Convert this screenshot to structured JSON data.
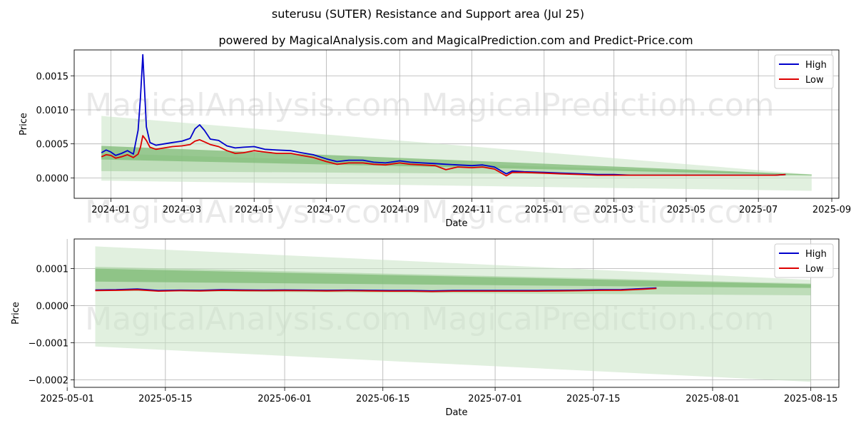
{
  "header": {
    "title": "suterusu (SUTER) Resistance and Support area (Jul 25)",
    "subtitle": "powered by MagicalAnalysis.com and MagicalPrediction.com and Predict-Price.com"
  },
  "watermarks": [
    "MagicalAnalysis.com",
    "MagicalPrediction.com"
  ],
  "colors": {
    "high": "#0000cc",
    "low": "#dd0000",
    "band_light": "#c8e3c4",
    "band_mid": "#a6d0a0",
    "band_dark": "#7fbb77",
    "grid": "#b0b0b0"
  },
  "chart_data": [
    {
      "type": "line",
      "xlabel": "Date",
      "ylabel": "Price",
      "ylim": [
        -0.0003,
        0.00188
      ],
      "xlim": [
        "2023-12-01",
        "2025-09-07"
      ],
      "x_ticks": [
        "2024-01",
        "2024-03",
        "2024-05",
        "2024-07",
        "2024-09",
        "2024-11",
        "2025-01",
        "2025-03",
        "2025-05",
        "2025-07",
        "2025-09"
      ],
      "y_ticks": [
        0.0,
        0.0005,
        0.001,
        0.0015
      ],
      "y_tick_labels": [
        "0.0000",
        "0.0005",
        "0.0010",
        "0.0015"
      ],
      "grid": true,
      "legend": "top-right",
      "series": [
        {
          "name": "High",
          "x": [
            "2023-12-24",
            "2023-12-28",
            "2024-01-01",
            "2024-01-05",
            "2024-01-10",
            "2024-01-15",
            "2024-01-20",
            "2024-01-24",
            "2024-01-26",
            "2024-01-28",
            "2024-01-31",
            "2024-02-03",
            "2024-02-08",
            "2024-02-15",
            "2024-02-22",
            "2024-03-01",
            "2024-03-08",
            "2024-03-12",
            "2024-03-16",
            "2024-03-20",
            "2024-03-25",
            "2024-04-01",
            "2024-04-08",
            "2024-04-15",
            "2024-04-22",
            "2024-05-01",
            "2024-05-10",
            "2024-05-20",
            "2024-06-01",
            "2024-06-10",
            "2024-06-20",
            "2024-07-01",
            "2024-07-10",
            "2024-07-20",
            "2024-08-01",
            "2024-08-10",
            "2024-08-20",
            "2024-09-01",
            "2024-09-10",
            "2024-09-20",
            "2024-10-01",
            "2024-10-10",
            "2024-10-20",
            "2024-11-01",
            "2024-11-10",
            "2024-11-20",
            "2024-11-30",
            "2024-12-05",
            "2024-12-15",
            "2025-01-01",
            "2025-01-15",
            "2025-02-01",
            "2025-02-15",
            "2025-03-01",
            "2025-03-15",
            "2025-04-01",
            "2025-04-15",
            "2025-05-01",
            "2025-05-15",
            "2025-06-01",
            "2025-06-15",
            "2025-07-01",
            "2025-07-15",
            "2025-07-24"
          ],
          "values": [
            0.00037,
            0.00041,
            0.00038,
            0.00033,
            0.00036,
            0.0004,
            0.00035,
            0.0007,
            0.00118,
            0.00181,
            0.00075,
            0.00052,
            0.00048,
            0.0005,
            0.00052,
            0.00054,
            0.00058,
            0.00072,
            0.00078,
            0.0007,
            0.00057,
            0.00055,
            0.00047,
            0.00044,
            0.00045,
            0.00046,
            0.00042,
            0.00041,
            0.0004,
            0.00037,
            0.00034,
            0.00028,
            0.00024,
            0.00026,
            0.00026,
            0.00023,
            0.00022,
            0.00025,
            0.00023,
            0.00022,
            0.00021,
            0.0002,
            0.00019,
            0.00018,
            0.00019,
            0.00016,
            6e-05,
            0.0001,
            9e-05,
            8e-05,
            7e-05,
            6e-05,
            5e-05,
            5e-05,
            4e-05,
            4e-05,
            4e-05,
            4e-05,
            4e-05,
            4e-05,
            4e-05,
            4e-05,
            4e-05,
            5e-05
          ]
        },
        {
          "name": "Low",
          "x": [
            "2023-12-24",
            "2023-12-28",
            "2024-01-01",
            "2024-01-05",
            "2024-01-10",
            "2024-01-15",
            "2024-01-20",
            "2024-01-24",
            "2024-01-26",
            "2024-01-28",
            "2024-01-31",
            "2024-02-03",
            "2024-02-08",
            "2024-02-15",
            "2024-02-22",
            "2024-03-01",
            "2024-03-08",
            "2024-03-12",
            "2024-03-16",
            "2024-03-20",
            "2024-03-25",
            "2024-04-01",
            "2024-04-08",
            "2024-04-15",
            "2024-04-22",
            "2024-05-01",
            "2024-05-10",
            "2024-05-20",
            "2024-06-01",
            "2024-06-10",
            "2024-06-20",
            "2024-07-01",
            "2024-07-10",
            "2024-07-20",
            "2024-08-01",
            "2024-08-10",
            "2024-08-20",
            "2024-09-01",
            "2024-09-10",
            "2024-09-20",
            "2024-10-01",
            "2024-10-10",
            "2024-10-20",
            "2024-11-01",
            "2024-11-10",
            "2024-11-20",
            "2024-11-30",
            "2024-12-05",
            "2024-12-15",
            "2025-01-01",
            "2025-01-15",
            "2025-02-01",
            "2025-02-15",
            "2025-03-01",
            "2025-03-15",
            "2025-04-01",
            "2025-04-15",
            "2025-05-01",
            "2025-05-15",
            "2025-06-01",
            "2025-06-15",
            "2025-07-01",
            "2025-07-15",
            "2025-07-24"
          ],
          "values": [
            0.00031,
            0.00034,
            0.00033,
            0.00029,
            0.00031,
            0.00034,
            0.0003,
            0.00035,
            0.00045,
            0.00062,
            0.00055,
            0.00045,
            0.00042,
            0.00044,
            0.00046,
            0.00047,
            0.00049,
            0.00054,
            0.00056,
            0.00053,
            0.00049,
            0.00046,
            0.0004,
            0.00036,
            0.00037,
            0.0004,
            0.00038,
            0.00036,
            0.00036,
            0.00033,
            0.0003,
            0.00024,
            0.0002,
            0.00022,
            0.00022,
            0.0002,
            0.00019,
            0.00022,
            0.0002,
            0.00019,
            0.00018,
            0.00012,
            0.00016,
            0.00015,
            0.00016,
            0.00013,
            3e-05,
            8e-05,
            8e-05,
            7e-05,
            6e-05,
            5e-05,
            4e-05,
            4e-05,
            4e-05,
            4e-05,
            4e-05,
            4e-05,
            4e-05,
            4e-05,
            4e-05,
            4e-05,
            4e-05,
            5e-05
          ]
        }
      ],
      "bands": [
        {
          "tone": "light",
          "x": [
            "2023-12-24",
            "2025-08-15"
          ],
          "upper": [
            0.00091,
            5e-05
          ],
          "lower": [
            -4e-05,
            -0.00019
          ]
        },
        {
          "tone": "mid",
          "x": [
            "2023-12-24",
            "2025-08-15"
          ],
          "upper": [
            0.00036,
            5e-05
          ],
          "lower": [
            0.0001,
            3e-05
          ]
        },
        {
          "tone": "dark",
          "x": [
            "2023-12-24",
            "2025-08-15"
          ],
          "upper": [
            0.00047,
            5e-05
          ],
          "lower": [
            0.00027,
            4e-05
          ]
        }
      ]
    },
    {
      "type": "line",
      "xlabel": "Date",
      "ylabel": "Price",
      "ylim": [
        -0.00022,
        0.00018
      ],
      "xlim": [
        "2025-05-02",
        "2025-08-19"
      ],
      "x_ticks": [
        "2025-05-01",
        "2025-05-15",
        "2025-06-01",
        "2025-06-15",
        "2025-07-01",
        "2025-07-15",
        "2025-08-01",
        "2025-08-15"
      ],
      "y_ticks": [
        -0.0002,
        -0.0001,
        0.0,
        0.0001
      ],
      "y_tick_labels": [
        "−0.0002",
        "−0.0001",
        "0.0000",
        "0.0001"
      ],
      "grid": true,
      "legend": "top-right",
      "series": [
        {
          "name": "High",
          "x": [
            "2025-05-05",
            "2025-05-08",
            "2025-05-11",
            "2025-05-14",
            "2025-05-17",
            "2025-05-20",
            "2025-05-23",
            "2025-05-26",
            "2025-05-29",
            "2025-06-01",
            "2025-06-04",
            "2025-06-07",
            "2025-06-10",
            "2025-06-13",
            "2025-06-16",
            "2025-06-19",
            "2025-06-22",
            "2025-06-25",
            "2025-06-28",
            "2025-07-01",
            "2025-07-04",
            "2025-07-07",
            "2025-07-10",
            "2025-07-13",
            "2025-07-16",
            "2025-07-19",
            "2025-07-22",
            "2025-07-24"
          ],
          "values": [
            4.25e-05,
            4.3e-05,
            4.5e-05,
            4.1e-05,
            4.2e-05,
            4.15e-05,
            4.3e-05,
            4.25e-05,
            4.2e-05,
            4.25e-05,
            4.2e-05,
            4.15e-05,
            4.2e-05,
            4.15e-05,
            4.1e-05,
            4.1e-05,
            4e-05,
            4.1e-05,
            4.1e-05,
            4.1e-05,
            4.1e-05,
            4.1e-05,
            4.15e-05,
            4.2e-05,
            4.3e-05,
            4.35e-05,
            4.6e-05,
            4.8e-05
          ]
        },
        {
          "name": "Low",
          "x": [
            "2025-05-05",
            "2025-05-08",
            "2025-05-11",
            "2025-05-14",
            "2025-05-17",
            "2025-05-20",
            "2025-05-23",
            "2025-05-26",
            "2025-05-29",
            "2025-06-01",
            "2025-06-04",
            "2025-06-07",
            "2025-06-10",
            "2025-06-13",
            "2025-06-16",
            "2025-06-19",
            "2025-06-22",
            "2025-06-25",
            "2025-06-28",
            "2025-07-01",
            "2025-07-04",
            "2025-07-07",
            "2025-07-10",
            "2025-07-13",
            "2025-07-16",
            "2025-07-19",
            "2025-07-22",
            "2025-07-24"
          ],
          "values": [
            4.1e-05,
            4.15e-05,
            4.3e-05,
            3.95e-05,
            4.05e-05,
            4e-05,
            4.15e-05,
            4.1e-05,
            4.05e-05,
            4.1e-05,
            4.05e-05,
            4e-05,
            4.05e-05,
            4e-05,
            3.95e-05,
            3.95e-05,
            3.85e-05,
            3.95e-05,
            3.95e-05,
            3.95e-05,
            3.95e-05,
            3.95e-05,
            4e-05,
            4.05e-05,
            4.15e-05,
            4.2e-05,
            4.45e-05,
            4.65e-05
          ]
        }
      ],
      "bands": [
        {
          "tone": "light",
          "x": [
            "2025-05-05",
            "2025-08-15"
          ],
          "upper": [
            0.00016,
            7e-05
          ],
          "lower": [
            -0.00011,
            -0.000205
          ]
        },
        {
          "tone": "mid",
          "x": [
            "2025-05-05",
            "2025-08-15"
          ],
          "upper": [
            0.000105,
            6e-05
          ],
          "lower": [
            4e-05,
            2.8e-05
          ]
        },
        {
          "tone": "dark",
          "x": [
            "2025-05-05",
            "2025-08-15"
          ],
          "upper": [
            0.0001,
            5.8e-05
          ],
          "lower": [
            6.5e-05,
            4.8e-05
          ]
        }
      ]
    }
  ]
}
